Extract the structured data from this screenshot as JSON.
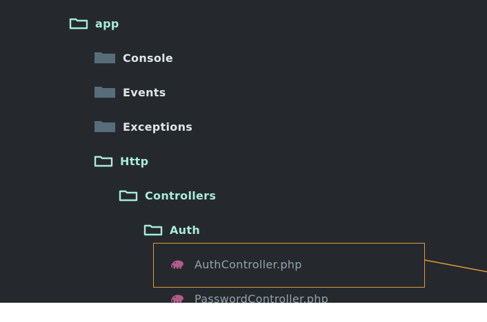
{
  "tree": {
    "items": [
      {
        "label": "app",
        "type": "folder-open"
      },
      {
        "label": "Console",
        "type": "folder-closed"
      },
      {
        "label": "Events",
        "type": "folder-closed"
      },
      {
        "label": "Exceptions",
        "type": "folder-closed"
      },
      {
        "label": "Http",
        "type": "folder-open"
      },
      {
        "label": "Controllers",
        "type": "folder-open"
      },
      {
        "label": "Auth",
        "type": "folder-open"
      },
      {
        "label": "AuthController.php",
        "type": "php-file"
      },
      {
        "label": "PasswordController.php",
        "type": "php-file"
      }
    ]
  },
  "colors": {
    "background": "#25292d",
    "open_folder": "#a8ecd9",
    "closed_folder": "#576d7a",
    "php_icon": "#b25c8a",
    "file_text": "#93a3ad",
    "highlight": "#e49a3b"
  }
}
